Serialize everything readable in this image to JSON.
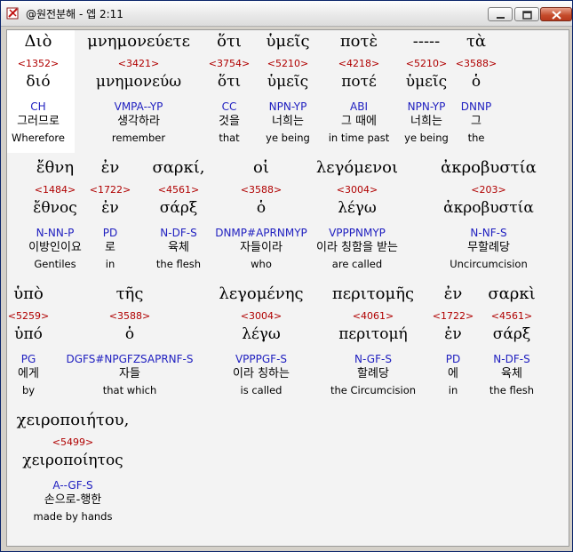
{
  "window": {
    "title": "@원전분해 - 엡 2:11"
  },
  "rows": [
    {
      "words": [
        {
          "greek": "Διὸ",
          "num": "<1352>",
          "lemma": "διό",
          "parse": "CH",
          "kor": "그러므로",
          "eng": "Wherefore"
        },
        {
          "greek": "μνημονεύετε",
          "num": "<3421>",
          "lemma": "μνημονεύω",
          "parse": "VMPA--YP",
          "kor": "생각하라",
          "eng": "remember"
        },
        {
          "greek": "ὅτι",
          "num": "<3754>",
          "lemma": "ὅτι",
          "parse": "CC",
          "kor": "것을",
          "eng": "that"
        },
        {
          "greek": "ὑμεῖς",
          "num": "<5210>",
          "lemma": "ὑμεῖς",
          "parse": "NPN-YP",
          "kor": "너희는",
          "eng": "ye being"
        },
        {
          "greek": "ποτὲ",
          "num": "<4218>",
          "lemma": "ποτέ",
          "parse": "ABI",
          "kor": "그 때에",
          "eng": "in time past"
        },
        {
          "greek": "-----",
          "num": "<5210>",
          "lemma": "ὑμεῖς",
          "parse": "NPN-YP",
          "kor": "너희는",
          "eng": "ye being"
        },
        {
          "greek": "τὰ",
          "num": "<3588>",
          "lemma": "ὁ",
          "parse": "DNNP",
          "kor": "그",
          "eng": "the"
        }
      ]
    },
    {
      "words": [
        {
          "greek": "ἔθνη",
          "num": "<1484>",
          "lemma": "ἔθνος",
          "parse": "N-NN-P",
          "kor": "이방인이요",
          "eng": "Gentiles"
        },
        {
          "greek": "ἐν",
          "num": "<1722>",
          "lemma": "ἐν",
          "parse": "PD",
          "kor": "로",
          "eng": "in"
        },
        {
          "greek": "σαρκί,",
          "num": "<4561>",
          "lemma": "σάρξ",
          "parse": "N-DF-S",
          "kor": "육체",
          "eng": "the flesh"
        },
        {
          "greek": "οἱ",
          "num": "<3588>",
          "lemma": "ὁ",
          "parse": "DNMP#APRNMYP",
          "kor": "자들이라",
          "eng": "who"
        },
        {
          "greek": "λεγόμενοι",
          "num": "<3004>",
          "lemma": "λέγω",
          "parse": "VPPPNMYP",
          "kor": "이라 칭함을 받는",
          "eng": "are called"
        },
        {
          "greek": "ἀκροβυστία",
          "num": "<203>",
          "lemma": "ἀκροβυστία",
          "parse": "N-NF-S",
          "kor": "무할례당",
          "eng": "Uncircumcision"
        }
      ]
    },
    {
      "words": [
        {
          "greek": "ὑπὸ",
          "num": "<5259>",
          "lemma": "ὑπό",
          "parse": "PG",
          "kor": "에게",
          "eng": "by"
        },
        {
          "greek": "τῆς",
          "num": "<3588>",
          "lemma": "ὁ",
          "parse": "DGFS#NPGFZSAPRNF-S",
          "kor": "자들",
          "eng": "that which"
        },
        {
          "greek": "λεγομένης",
          "num": "<3004>",
          "lemma": "λέγω",
          "parse": "VPPPGF-S",
          "kor": "이라 칭하는",
          "eng": "is called"
        },
        {
          "greek": "περιτομῆς",
          "num": "<4061>",
          "lemma": "περιτομή",
          "parse": "N-GF-S",
          "kor": "할례당",
          "eng": "the Circumcision"
        },
        {
          "greek": "ἐν",
          "num": "<1722>",
          "lemma": "ἐν",
          "parse": "PD",
          "kor": "에",
          "eng": "in"
        },
        {
          "greek": "σαρκὶ",
          "num": "<4561>",
          "lemma": "σάρξ",
          "parse": "N-DF-S",
          "kor": "육체",
          "eng": "the flesh"
        }
      ]
    },
    {
      "words": [
        {
          "greek": "χειροποιήτου,",
          "num": "<5499>",
          "lemma": "χειροποίητος",
          "parse": "A--GF-S",
          "kor": "손으로-행한",
          "eng": "made by hands"
        }
      ]
    }
  ]
}
